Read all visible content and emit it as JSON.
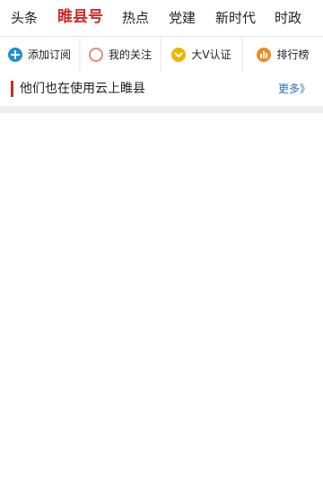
{
  "tabs": [
    {
      "label": "头条",
      "active": false
    },
    {
      "label": "睢县号",
      "active": true
    },
    {
      "label": "热点",
      "active": false
    },
    {
      "label": "党建",
      "active": false
    },
    {
      "label": "新时代",
      "active": false
    },
    {
      "label": "时政",
      "active": false
    }
  ],
  "shortcuts": [
    {
      "label": "添加订阅",
      "icon": "plus-circle-icon",
      "color": "#1d8fd6"
    },
    {
      "label": "我的关注",
      "icon": "circle-outline-icon",
      "color": "#e48a8a"
    },
    {
      "label": "大V认证",
      "icon": "check-badge-icon",
      "color": "#f0b400"
    },
    {
      "label": "排行榜",
      "icon": "bar-chart-icon",
      "color": "#ef8a1e"
    }
  ],
  "section": {
    "title": "他们也在使用云上睢县",
    "more_label": "更多》"
  },
  "colors": {
    "accent": "#cc2b2b",
    "link": "#2a6fb7"
  }
}
